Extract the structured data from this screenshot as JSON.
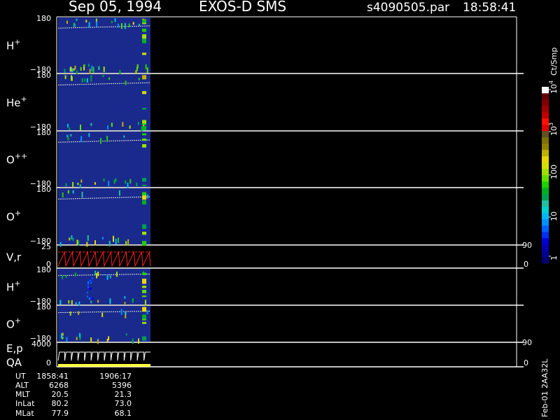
{
  "header": {
    "date": "Sep 05, 1994",
    "mission": "EXOS-D SMS",
    "file": "s4090505.par",
    "time": "18:58:41"
  },
  "chart_data": {
    "type": "heatmap",
    "panels": [
      {
        "label": "H",
        "sup": "+",
        "ytop": "180",
        "ybot": "−180",
        "kind": "spec"
      },
      {
        "label": "He",
        "sup": "+",
        "ytop": "180",
        "ybot": "−180",
        "kind": "spec"
      },
      {
        "label": "O",
        "sup": "++",
        "ytop": "180",
        "ybot": "−180",
        "kind": "spec"
      },
      {
        "label": "O",
        "sup": "+",
        "ytop": "180",
        "ybot": "−180",
        "kind": "spec"
      },
      {
        "label": "V,r",
        "sup": "",
        "ytop": "25",
        "ybot": "0",
        "kind": "line",
        "rtop": "90",
        "rbot": "0"
      },
      {
        "label": "H",
        "sup": "+",
        "ytop": "180",
        "ybot": "−180",
        "kind": "spec"
      },
      {
        "label": "O",
        "sup": "+",
        "ytop": "180",
        "ybot": "−180",
        "kind": "spec"
      },
      {
        "label": "E,p",
        "label2": "QA",
        "sup": "",
        "ytop": "4000",
        "ybot": "0",
        "kind": "ep",
        "rtop": "90",
        "rbot": "0"
      }
    ],
    "colorbar": {
      "unit": "Ct/Smp",
      "ticks": [
        {
          "label": "1",
          "value": 1
        },
        {
          "label": "10",
          "value": 10
        },
        {
          "label": "100",
          "value": 100
        },
        {
          "label": "10",
          "sup": "3",
          "value": 1000
        },
        {
          "label": "10",
          "sup": "4",
          "value": 10000
        }
      ],
      "colors": [
        "#000070",
        "#000090",
        "#0000b0",
        "#0000d8",
        "#0030f0",
        "#0060ff",
        "#0090ff",
        "#00b8f0",
        "#00d0d0",
        "#20c0a0",
        "#00a050",
        "#00b020",
        "#20d000",
        "#60e000",
        "#a0e000",
        "#d0e000",
        "#e8d800",
        "#c0b000",
        "#908000",
        "#807000",
        "#605020",
        "#e00000",
        "#ff1000",
        "#c00000",
        "#a00000",
        "#800000",
        "#600000",
        "#ffffff"
      ]
    },
    "ephemeris": {
      "rows": [
        "UT",
        "ALT",
        "MLT",
        "InLat",
        "MLat"
      ],
      "columns": [
        [
          "1858:41",
          "6268",
          "20.5",
          "80.2",
          "77.9"
        ],
        [
          "1906:17",
          "5396",
          "21.3",
          "73.0",
          "68.1"
        ]
      ]
    },
    "side_label": "Feb-01 2AA32L"
  }
}
